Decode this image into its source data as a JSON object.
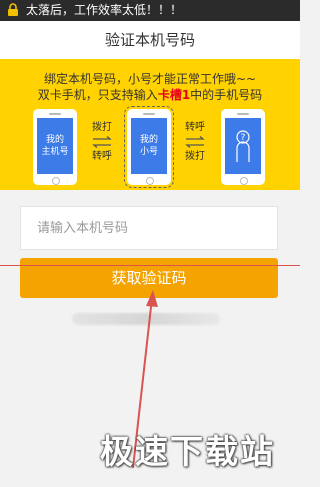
{
  "status_bar": {
    "message": "太落后，工作效率太低！！！"
  },
  "header": {
    "title": "验证本机号码"
  },
  "banner": {
    "line1": "绑定本机号码，小号才能正常工作哦~~",
    "line2_prefix": "双卡手机，只支持输入",
    "line2_highlight": "卡槽1",
    "line2_suffix": "中的手机号码",
    "phones": [
      {
        "label": "我的\n主机号"
      },
      {
        "label": "我的\n小号"
      },
      {
        "label": "?"
      }
    ],
    "transfers": [
      {
        "top": "拨打",
        "bottom": "转呼"
      },
      {
        "top": "转呼",
        "bottom": "拨打"
      }
    ]
  },
  "form": {
    "phone_placeholder": "请输入本机号码",
    "phone_value": "",
    "get_code_label": "获取验证码"
  },
  "watermark": "极速下载站",
  "colors": {
    "banner": "#ffd200",
    "button": "#f4a300",
    "phone_screen": "#3c7be8",
    "highlight": "#e8001c",
    "annotation": "#d9534f"
  }
}
